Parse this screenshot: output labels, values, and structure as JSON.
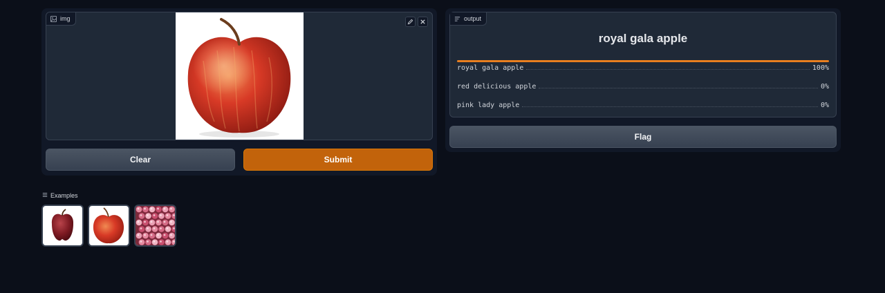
{
  "input": {
    "label": "img",
    "tools": [
      "edit-icon",
      "close-icon"
    ]
  },
  "buttons": {
    "clear": "Clear",
    "submit": "Submit",
    "flag": "Flag"
  },
  "output": {
    "label": "output",
    "top_label": "royal gala apple",
    "confidences": [
      {
        "label": "royal gala apple",
        "value": "100%",
        "fraction": 1.0
      },
      {
        "label": "red delicious apple",
        "value": "0%",
        "fraction": 0.0
      },
      {
        "label": "pink lady apple",
        "value": "0%",
        "fraction": 0.0
      }
    ]
  },
  "examples": {
    "label": "Examples",
    "items": [
      "red delicious apple thumbnail",
      "royal gala apple thumbnail",
      "pink lady apples pile thumbnail"
    ]
  },
  "colors": {
    "background": "#0b0f19",
    "panel": "#111827",
    "accent": "#c2630b",
    "confidence_bar": "#e97f1f"
  }
}
